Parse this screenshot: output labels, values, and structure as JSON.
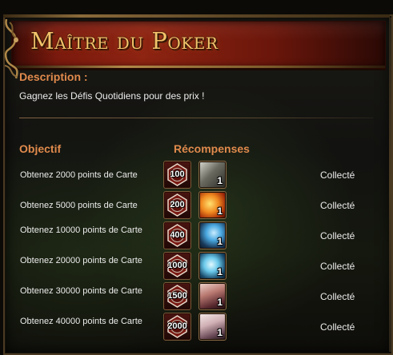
{
  "window": {
    "title": "Maître du Poker"
  },
  "description": {
    "label": "Description :",
    "text": "Gagnez les Défis Quotidiens pour des prix !"
  },
  "table": {
    "objective_header": "Objectif",
    "rewards_header": "Récompenses",
    "rows": [
      {
        "objective": "Obtenez 2000 points de Carte",
        "token": "100",
        "card_qty": "1",
        "card_icon": "cards-gray-icon",
        "status": "Collecté"
      },
      {
        "objective": "Obtenez 5000 points de Carte",
        "token": "200",
        "card_qty": "1",
        "card_icon": "cards-fire-icon",
        "status": "Collecté"
      },
      {
        "objective": "Obtenez 10000 points de Carte",
        "token": "400",
        "card_qty": "1",
        "card_icon": "cards-blue-icon",
        "status": "Collecté"
      },
      {
        "objective": "Obtenez 20000 points de Carte",
        "token": "1000",
        "card_qty": "1",
        "card_icon": "cards-ice-icon",
        "status": "Collecté"
      },
      {
        "objective": "Obtenez 30000 points de Carte",
        "token": "1500",
        "card_qty": "1",
        "card_icon": "card-portrait-icon",
        "status": "Collecté"
      },
      {
        "objective": "Obtenez 40000 points de Carte",
        "token": "2000",
        "card_qty": "1",
        "card_icon": "card-portrait-pale-icon",
        "status": "Collecté"
      }
    ]
  },
  "colors": {
    "accent_orange": "#e08a4c",
    "title_gold": "#f2c46a",
    "banner_red": "#8e2412",
    "text_light": "#ececec"
  }
}
